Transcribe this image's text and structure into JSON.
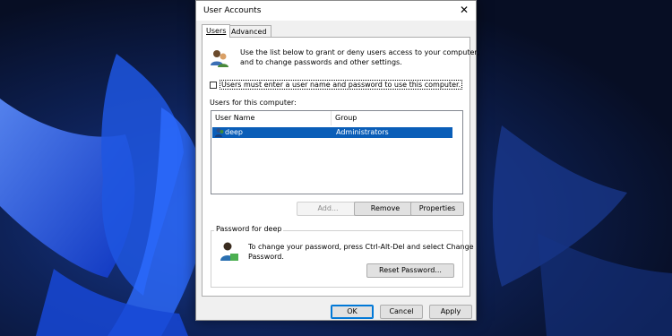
{
  "window": {
    "title": "User Accounts"
  },
  "tabs": [
    {
      "label": "Users"
    },
    {
      "label": "Advanced"
    }
  ],
  "intro_text": {
    "line1": "Use the list below to grant or deny users access to your computer,",
    "line2": "and to change passwords and other settings."
  },
  "checkbox": {
    "label": "Users must enter a user name and password to use this computer.",
    "checked": false
  },
  "users_list": {
    "heading": "Users for this computer:",
    "columns": [
      "User Name",
      "Group"
    ],
    "rows": [
      {
        "user_name": "deep",
        "group": "Administrators",
        "selected": true
      }
    ]
  },
  "buttons": {
    "add": "Add...",
    "remove": "Remove",
    "properties": "Properties"
  },
  "password_group": {
    "title": "Password for deep",
    "line1": "To change your password, press Ctrl-Alt-Del and select Change",
    "line2": "Password.",
    "reset_button": "Reset Password..."
  },
  "footer": {
    "ok": "OK",
    "cancel": "Cancel",
    "apply": "Apply"
  },
  "colors": {
    "selection": "#0a5eb8",
    "accent": "#0078d7"
  },
  "icons": [
    "users-icon",
    "user-row-icon",
    "user-key-icon",
    "close-icon"
  ]
}
